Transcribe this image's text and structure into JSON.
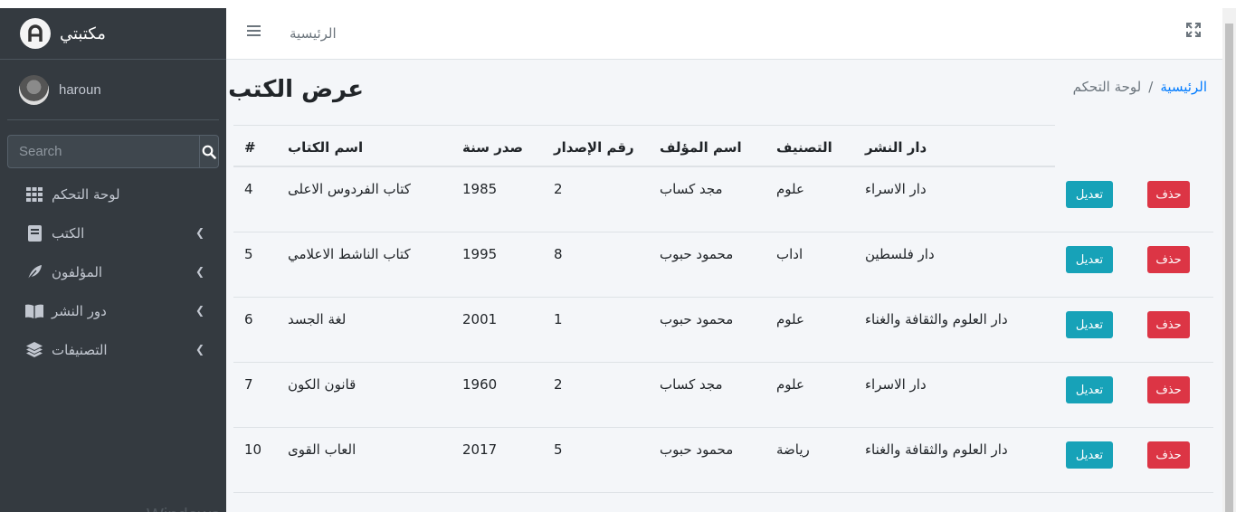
{
  "sidebar": {
    "brand_name": "مكتبتي",
    "user_name": "haroun",
    "search_placeholder": "Search",
    "items": [
      {
        "label": "لوحة التحكم",
        "icon": "grid-icon"
      },
      {
        "label": "الكتب",
        "icon": "book-icon"
      },
      {
        "label": "المؤلفون",
        "icon": "feather-icon"
      },
      {
        "label": "دور النشر",
        "icon": "open-book-icon"
      },
      {
        "label": "التصنيفات",
        "icon": "layers-icon"
      }
    ]
  },
  "watermark": "Windows تنشيط",
  "navbar": {
    "home_link": "الرئيسية"
  },
  "page": {
    "title": "عرض الكتب"
  },
  "breadcrumb": {
    "link": "الرئيسية",
    "current": "لوحة التحكم",
    "separator": "/"
  },
  "table": {
    "headers": {
      "num": "#",
      "title": "اسم الكتاب",
      "year": "صدر سنة",
      "edition": "رقم الإصدار",
      "author": "اسم المؤلف",
      "category": "التصنيف",
      "publisher": "دار النشر"
    },
    "edit_label": "تعديل",
    "delete_label": "حذف",
    "rows": [
      {
        "num": "4",
        "title": "كتاب الفردوس الاعلى",
        "year": "1985",
        "edition": "2",
        "author": "مجد كساب",
        "category": "علوم",
        "publisher": "دار الاسراء"
      },
      {
        "num": "5",
        "title": "كتاب الناشط الاعلامي",
        "year": "1995",
        "edition": "8",
        "author": "محمود حبوب",
        "category": "اداب",
        "publisher": "دار فلسطين"
      },
      {
        "num": "6",
        "title": "لغة الجسد",
        "year": "2001",
        "edition": "1",
        "author": "محمود حبوب",
        "category": "علوم",
        "publisher": "دار العلوم والثقافة والغناء"
      },
      {
        "num": "7",
        "title": "قانون الكون",
        "year": "1960",
        "edition": "2",
        "author": "مجد كساب",
        "category": "علوم",
        "publisher": "دار الاسراء"
      },
      {
        "num": "10",
        "title": "العاب القوى",
        "year": "2017",
        "edition": "5",
        "author": "محمود حبوب",
        "category": "رياضة",
        "publisher": "دار العلوم والثقافة والغناء"
      }
    ]
  },
  "colors": {
    "sidebar_bg": "#343a40",
    "edit": "#17a2b8",
    "delete": "#dc3545",
    "link": "#007bff"
  }
}
